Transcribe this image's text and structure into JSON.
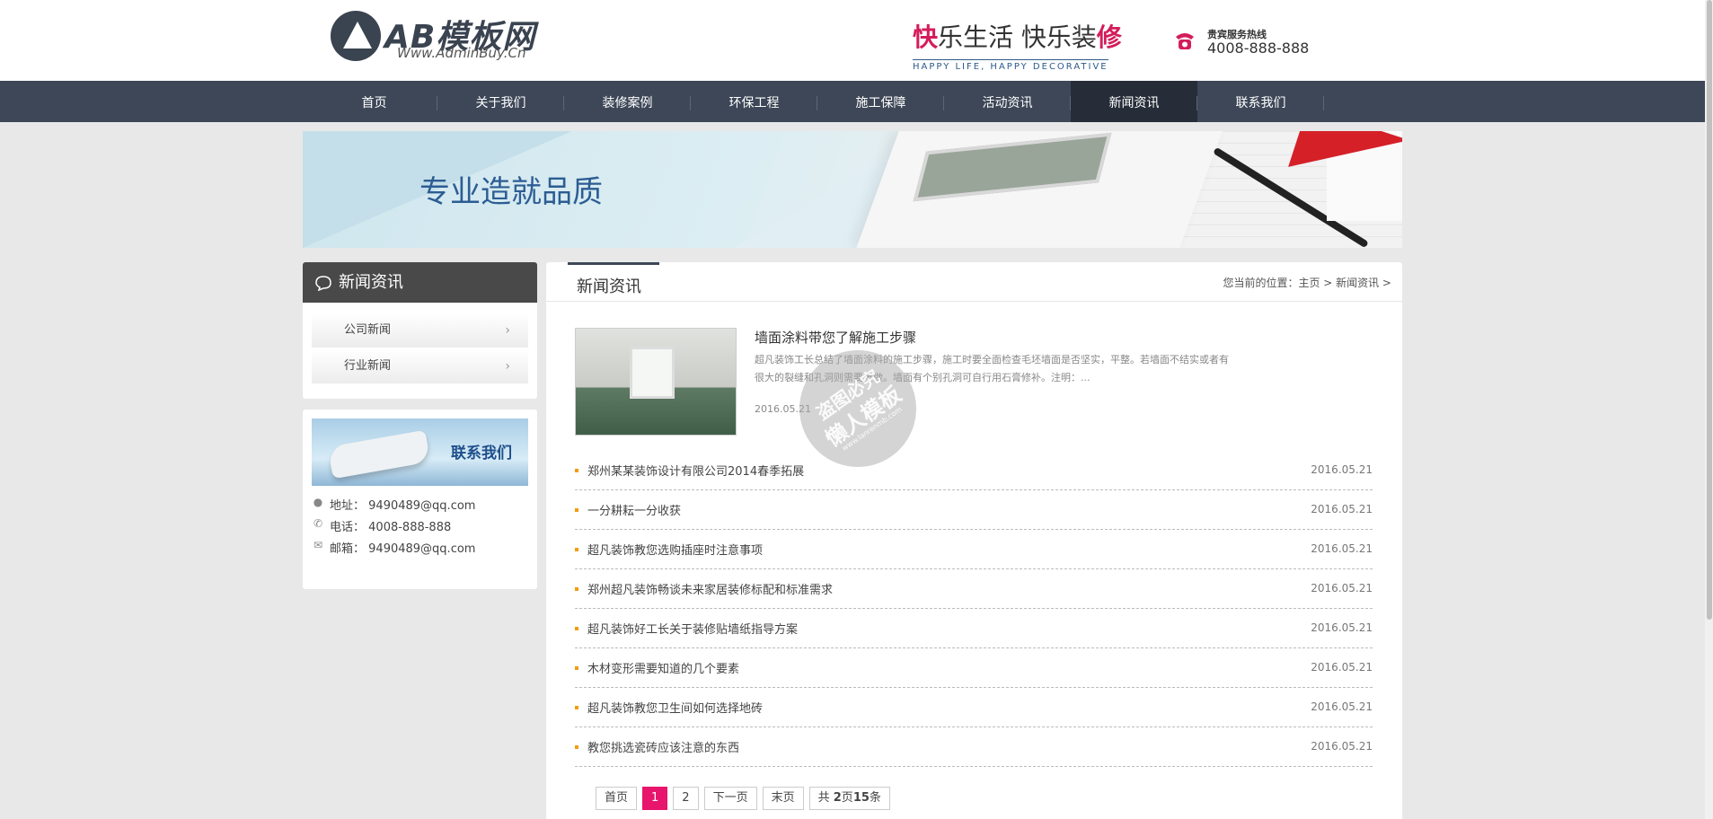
{
  "header": {
    "logo_brand": "AB模板网",
    "logo_url": "Www.AdminBuy.Cn",
    "slogan_part1": "快",
    "slogan_part2": "乐生活 快乐装",
    "slogan_part3": "修",
    "slogan_en": "HAPPY LIFE, HAPPY DECORATIVE",
    "hotline_label": "贵宾服务热线",
    "hotline_number": "4008-888-888"
  },
  "nav": {
    "items": [
      {
        "label": "首页"
      },
      {
        "label": "关于我们"
      },
      {
        "label": "装修案例"
      },
      {
        "label": "环保工程"
      },
      {
        "label": "施工保障"
      },
      {
        "label": "活动资讯"
      },
      {
        "label": "新闻资讯"
      },
      {
        "label": "联系我们"
      }
    ],
    "active_index": 6
  },
  "banner": {
    "text": "专业造就品质"
  },
  "sidebar": {
    "title": "新闻资讯",
    "items": [
      {
        "label": "公司新闻"
      },
      {
        "label": "行业新闻"
      }
    ]
  },
  "contact": {
    "title": "联系我们",
    "address_label": "地址：",
    "address": "9490489@qq.com",
    "phone_label": "电话：",
    "phone": "4008-888-888",
    "email_label": "邮箱：",
    "email": "9490489@qq.com"
  },
  "main": {
    "title": "新闻资讯",
    "breadcrumb": "您当前的位置：主页 > 新闻资讯 >",
    "featured": {
      "title": "墙面涂料带您了解施工步骤",
      "desc": "超凡装饰工长总结了墙面涂料的施工步骤，施工时要全面检查毛坯墙面是否坚实，平整。若墙面不结实或者有很大的裂缝和孔洞则需要重做。墙面有个别孔洞可自行用石膏修补。注明：...",
      "date": "2016.05.21"
    },
    "news": [
      {
        "title": "郑州某某装饰设计有限公司2014春季拓展",
        "date": "2016.05.21"
      },
      {
        "title": "一分耕耘一分收获",
        "date": "2016.05.21"
      },
      {
        "title": "超凡装饰教您选购插座时注意事项",
        "date": "2016.05.21"
      },
      {
        "title": "郑州超凡装饰畅谈未来家居装修标配和标准需求",
        "date": "2016.05.21"
      },
      {
        "title": "超凡装饰好工长关于装修贴墙纸指导方案",
        "date": "2016.05.21"
      },
      {
        "title": "木材变形需要知道的几个要素",
        "date": "2016.05.21"
      },
      {
        "title": "超凡装饰教您卫生间如何选择地砖",
        "date": "2016.05.21"
      },
      {
        "title": "教您挑选瓷砖应该注意的东西",
        "date": "2016.05.21"
      }
    ]
  },
  "pager": {
    "first": "首页",
    "page1": "1",
    "page2": "2",
    "next": "下一页",
    "last": "末页",
    "total_prefix": "共 ",
    "total_pages": "2",
    "total_mid": "页",
    "total_items": "15",
    "total_suffix": "条",
    "current_page": 1
  },
  "watermark": {
    "line1": "盗图必究",
    "line2": "懒人模板",
    "line3": "www.lanrenmb.com"
  },
  "colors": {
    "nav_bg": "#3d4757",
    "accent_pink": "#e8156c",
    "bullet": "#f39c12"
  }
}
